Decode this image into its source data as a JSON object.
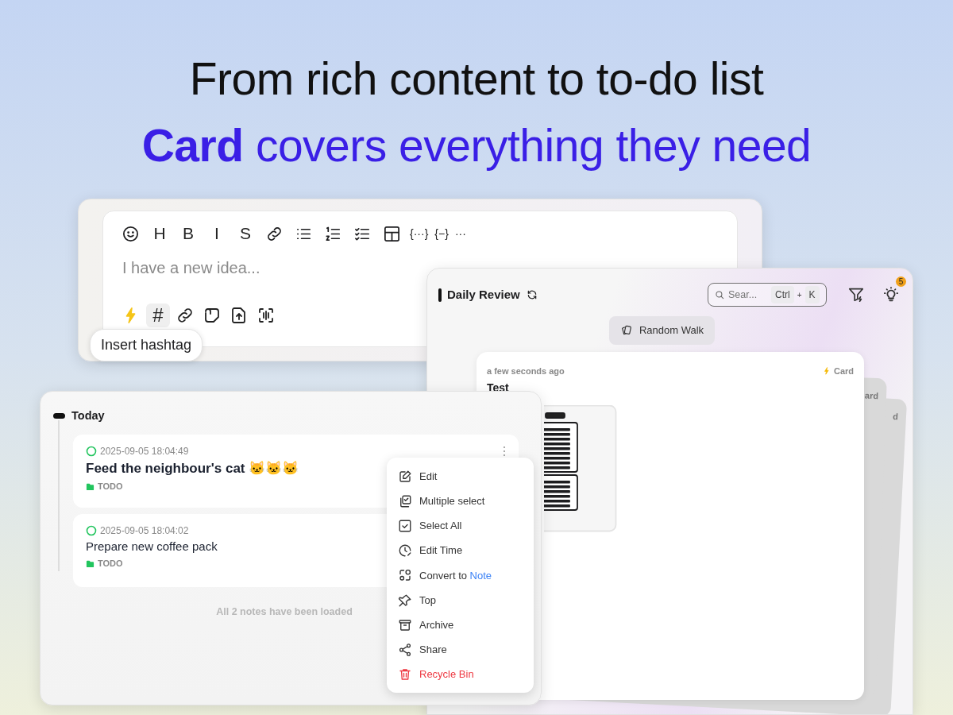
{
  "headline": {
    "line1": "From rich content to to-do list",
    "line2": "**Card** covers everything they need"
  },
  "editor": {
    "toolbar": [
      {
        "kind": "icon"
      },
      {
        "kind": "glyph",
        "text": "H"
      },
      {
        "kind": "glyph",
        "text": "B"
      },
      {
        "kind": "glyph",
        "text": "I"
      },
      {
        "kind": "glyph",
        "text": "S"
      },
      {
        "kind": "icon"
      },
      {
        "kind": "icon"
      },
      {
        "kind": "icon"
      },
      {
        "kind": "icon"
      },
      {
        "kind": "icon"
      },
      {
        "kind": "glyph",
        "text": "{···}"
      },
      {
        "kind": "glyph",
        "text": "{−}"
      },
      {
        "kind": "glyph",
        "text": "···"
      }
    ],
    "placeholder": "I have a new idea...",
    "actions": [
      {
        "kind": "icon",
        "selected": false
      },
      {
        "kind": "glyph",
        "text": "#",
        "selected": true
      },
      {
        "kind": "icon",
        "selected": false
      },
      {
        "kind": "icon",
        "selected": false
      },
      {
        "kind": "icon",
        "selected": false
      },
      {
        "kind": "icon",
        "selected": false
      }
    ],
    "tooltip": "Insert hashtag"
  },
  "daily_review": {
    "title": "Daily Review",
    "search": {
      "placeholder": "Sear...",
      "keys": [
        "Ctrl",
        "+",
        "K"
      ]
    },
    "notification_count": "5",
    "random_walk": "Random Walk",
    "card": {
      "time": "a few seconds ago",
      "tag": "Card",
      "title": "Test"
    },
    "stacked_cards": [
      "ard",
      "d"
    ]
  },
  "today": {
    "heading": "Today",
    "notes": [
      {
        "checked": false,
        "time": "2025-09-05 18:04:49",
        "kind": "heading",
        "text": "Feed the neighbour's cat 🐱🐱🐱",
        "tag": "TODO"
      },
      {
        "checked": false,
        "time": "2025-09-05 18:04:02",
        "kind": "text",
        "text": "Prepare new coffee pack",
        "tag": "TODO"
      }
    ],
    "footer": "All 2 notes have been loaded"
  },
  "context_menu": [
    {
      "kind": "normal",
      "label": "Edit"
    },
    {
      "kind": "normal",
      "label": "Multiple select"
    },
    {
      "kind": "normal",
      "label": "Select All"
    },
    {
      "kind": "normal",
      "label": "Edit Time"
    },
    {
      "kind": "normal",
      "label": "Convert to",
      "highlight": "Note"
    },
    {
      "kind": "normal",
      "label": "Top"
    },
    {
      "kind": "normal",
      "label": "Archive"
    },
    {
      "kind": "normal",
      "label": "Share"
    },
    {
      "kind": "danger",
      "label": "Recycle Bin"
    }
  ]
}
